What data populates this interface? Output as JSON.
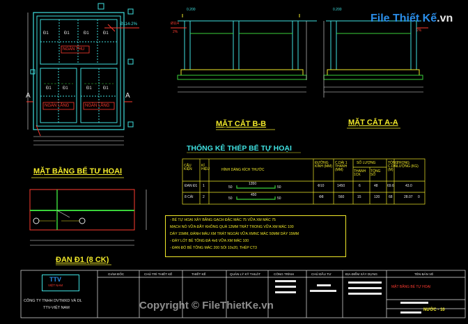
{
  "labels": {
    "plan_title": "MẶT BẰNG BỂ TỰ HOẠI",
    "section_bb": "MẶT CẮT B-B",
    "section_aa": "MẶT CẮT A-A",
    "slab_title": "ĐAN Đ1 (8 CK)",
    "rebar_table_title": "THỐNG KÊ THÉP BỂ TỰ HOẠI",
    "room_ngan_thu": "NGĂN THU",
    "room_ngan_lang1": "NGĂN LẮNG",
    "room_ngan_lang2": "NGĂN LẮNG",
    "section_mark_a_left": "A",
    "section_mark_a_right": "A",
    "slab_mark": "Đ1",
    "pipe_label": "Ø114-2%",
    "slope": "2%",
    "pipe_label2": "Ø114",
    "slope2": "2%",
    "elev": "0.200"
  },
  "rebar_table": {
    "headers": [
      "CẤU KIỆN",
      "KÍ HIỆU",
      "HÌNH DÁNG KÍCH THƯỚC",
      "ĐƯỜNG KÍNH (MM)",
      "C.DÀI 1 THANH (MM)",
      "SỐ LƯỢNG 1CK",
      "SỐ LƯỢNG TỔNG SỐ",
      "TỔNG C.DÀI (M)",
      "TRỌNG LƯỢNG (KG)"
    ],
    "group_header": "SỐ LƯỢNG",
    "headers_sub": [
      "THANH 1CK",
      "TỔNG SỐ"
    ],
    "rows": [
      {
        "member": "ĐAN Đ1",
        "mark": "1",
        "shape_left": "50",
        "shape_mid": "1350",
        "shape_right": "50",
        "dia": "Ф10",
        "len": "1450",
        "qty1": "6",
        "qty": "48",
        "total_len": "69.6",
        "weight": "43.0"
      },
      {
        "member": "8 CÁI",
        "mark": "2",
        "shape_left": "50",
        "shape_mid": "450",
        "shape_right": "50",
        "dia": "Ф8",
        "len": "560",
        "qty1": "15",
        "qty": "120",
        "total_len": "68",
        "weight": "28.07"
      }
    ],
    "total_note": "0"
  },
  "notes": [
    "- BỂ TỰ HOẠI XÂY BẰNG GẠCH ĐẶC MÁC 75 VỮA XM MÁC 75",
    "  MẠCH NÓ VỮA ĐẦY KHÔNG QUÁ 12MM TRÁT TRONG VỮA XM MÁC 100",
    "  DÀY 15MM, ĐÁNH MÀU XM TRÁT NGOÀI VỮA XMNC MÁC 50MM DÀY 15MM",
    "- ĐÁY LÓT BÊ TÔNG ĐÁ 4x6 VỮA XM MÁC 100",
    "- ĐAN ĐỔ BÊ TÔNG MÁC 200 SỎI 10x20, THÉP CT3"
  ],
  "title_block": {
    "company_line1": "CÔNG TY TNHH DVTMXD VÀ DL",
    "company_line2": "TTV-VIỆT NAM",
    "logo_text": "TTV",
    "logo_sub": "VIỆT NAM",
    "col_giam_doc": "GIÁM ĐỐC",
    "col_chu_tri_tk": "CHỦ TRÌ THIẾT KẾ",
    "col_thiet_ke": "THIẾT KẾ",
    "col_quan_ly": "QUẢN LÝ KỸ THUẬT",
    "col_cong_trinh": "CÔNG TRÌNH",
    "col_chu_dau_tu": "CHỦ ĐẦU TƯ",
    "col_dia_diem": "ĐỊA ĐIỂM XÂY DỰNG",
    "col_ten_ban_ve": "TÊN BẢN VẼ",
    "drawing_name": "MẶT BẰNG BỂ TỰ HOẠI",
    "sheet_no": "NƯỚC - 10"
  },
  "watermark": "Copyright © FileThietKe.vn",
  "brand": {
    "text": "File Thiết Kế",
    "domain": ".vn"
  },
  "colors": {
    "background": "#000000",
    "lines": "#f2ea2a",
    "annotation": "#3fe0e0",
    "hatch": "#3ad23a",
    "red": "#ff3b30",
    "white": "#e8e8e8"
  }
}
